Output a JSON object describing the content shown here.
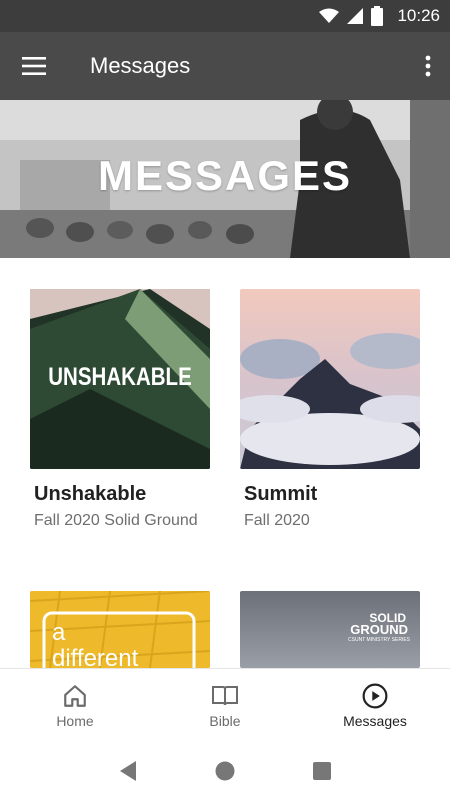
{
  "status": {
    "time": "10:26",
    "icons": [
      "wifi-icon",
      "signal-icon",
      "battery-icon"
    ]
  },
  "app_bar": {
    "title": "Messages",
    "menu_icon": "hamburger-menu-icon",
    "overflow_icon": "more-vert-icon"
  },
  "hero": {
    "title": "MESSAGES"
  },
  "cards": [
    {
      "title": "Unshakable",
      "subtitle": "Fall 2020 Solid Ground",
      "art_text": "UNSHAKABLE"
    },
    {
      "title": "Summit",
      "subtitle": "Fall 2020"
    },
    {
      "title": "",
      "subtitle": "",
      "art_text_1": "a",
      "art_text_2": "different"
    },
    {
      "title": "",
      "subtitle": "",
      "art_line_1": "SOLID",
      "art_line_2": "GROUND",
      "art_line_3": "CSUNT MINISTRY SERIES"
    }
  ],
  "bottom_nav": {
    "items": [
      {
        "label": "Home",
        "icon": "home-icon"
      },
      {
        "label": "Bible",
        "icon": "book-icon"
      },
      {
        "label": "Messages",
        "icon": "play-circle-icon"
      }
    ],
    "active_index": 2
  },
  "colors": {
    "status_bar": "#3d3d3d",
    "app_bar": "#4a4a4a",
    "text_primary": "#212121",
    "text_secondary": "#6e6e6e"
  }
}
